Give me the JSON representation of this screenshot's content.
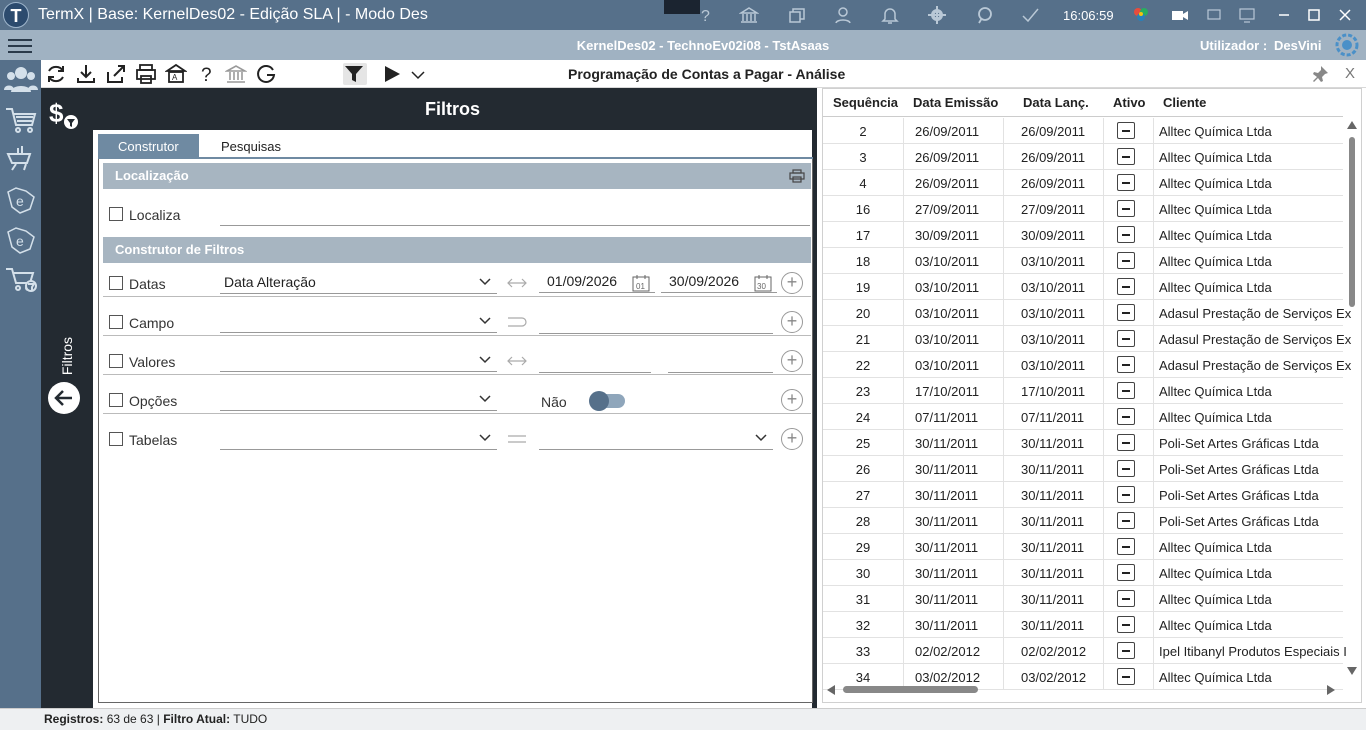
{
  "window": {
    "title": "TermX | Base: KernelDes02 - Edição SLA | - Modo Des",
    "clock": "16:06:59"
  },
  "infobar": {
    "environment": "KernelDes02 - TechnoEv02i08 - TstAsaas",
    "user_label": "Utilizador :",
    "user_name": "DesVini"
  },
  "toolbar": {
    "page_title": "Programação de Contas a Pagar - Análise",
    "close": "X"
  },
  "sidepanel": {
    "label": "Filtros"
  },
  "filters": {
    "header": "Filtros",
    "tabs": [
      "Construtor",
      "Pesquisas"
    ],
    "localizacao": {
      "section": "Localização",
      "label": "Localiza",
      "value": ""
    },
    "construtor": {
      "section": "Construtor de Filtros",
      "datas": {
        "label": "Datas",
        "field": "Data Alteração",
        "from": "01/09/2026",
        "to": "30/09/2026",
        "cal_from": "01",
        "cal_to": "30"
      },
      "campo": {
        "label": "Campo"
      },
      "valores": {
        "label": "Valores"
      },
      "opcoes": {
        "label": "Opções",
        "toggle_text": "Não",
        "toggle_on": false
      },
      "tabelas": {
        "label": "Tabelas"
      }
    }
  },
  "grid": {
    "columns": [
      "Sequência",
      "Data Emissão",
      "Data Lanç.",
      "Ativo",
      "Cliente"
    ],
    "rows": [
      {
        "seq": "2",
        "emissao": "26/09/2011",
        "lanc": "26/09/2011",
        "cliente": "Alltec Química Ltda"
      },
      {
        "seq": "3",
        "emissao": "26/09/2011",
        "lanc": "26/09/2011",
        "cliente": "Alltec Química Ltda"
      },
      {
        "seq": "4",
        "emissao": "26/09/2011",
        "lanc": "26/09/2011",
        "cliente": "Alltec Química Ltda"
      },
      {
        "seq": "16",
        "emissao": "27/09/2011",
        "lanc": "27/09/2011",
        "cliente": "Alltec Química Ltda"
      },
      {
        "seq": "17",
        "emissao": "30/09/2011",
        "lanc": "30/09/2011",
        "cliente": "Alltec Química Ltda"
      },
      {
        "seq": "18",
        "emissao": "03/10/2011",
        "lanc": "03/10/2011",
        "cliente": "Alltec Química Ltda"
      },
      {
        "seq": "19",
        "emissao": "03/10/2011",
        "lanc": "03/10/2011",
        "cliente": "Alltec Química Ltda"
      },
      {
        "seq": "20",
        "emissao": "03/10/2011",
        "lanc": "03/10/2011",
        "cliente": "Adasul Prestação de Serviços Ex"
      },
      {
        "seq": "21",
        "emissao": "03/10/2011",
        "lanc": "03/10/2011",
        "cliente": "Adasul Prestação de Serviços Ex"
      },
      {
        "seq": "22",
        "emissao": "03/10/2011",
        "lanc": "03/10/2011",
        "cliente": "Adasul Prestação de Serviços Ex"
      },
      {
        "seq": "23",
        "emissao": "17/10/2011",
        "lanc": "17/10/2011",
        "cliente": "Alltec Química Ltda"
      },
      {
        "seq": "24",
        "emissao": "07/11/2011",
        "lanc": "07/11/2011",
        "cliente": "Alltec Química Ltda"
      },
      {
        "seq": "25",
        "emissao": "30/11/2011",
        "lanc": "30/11/2011",
        "cliente": "Poli-Set Artes Gráficas Ltda"
      },
      {
        "seq": "26",
        "emissao": "30/11/2011",
        "lanc": "30/11/2011",
        "cliente": "Poli-Set Artes Gráficas Ltda"
      },
      {
        "seq": "27",
        "emissao": "30/11/2011",
        "lanc": "30/11/2011",
        "cliente": "Poli-Set Artes Gráficas Ltda"
      },
      {
        "seq": "28",
        "emissao": "30/11/2011",
        "lanc": "30/11/2011",
        "cliente": "Poli-Set Artes Gráficas Ltda"
      },
      {
        "seq": "29",
        "emissao": "30/11/2011",
        "lanc": "30/11/2011",
        "cliente": "Alltec Química Ltda"
      },
      {
        "seq": "30",
        "emissao": "30/11/2011",
        "lanc": "30/11/2011",
        "cliente": "Alltec Química Ltda"
      },
      {
        "seq": "31",
        "emissao": "30/11/2011",
        "lanc": "30/11/2011",
        "cliente": "Alltec Química Ltda"
      },
      {
        "seq": "32",
        "emissao": "30/11/2011",
        "lanc": "30/11/2011",
        "cliente": "Alltec Química Ltda"
      },
      {
        "seq": "33",
        "emissao": "02/02/2012",
        "lanc": "02/02/2012",
        "cliente": "Ipel Itibanyl Produtos Especiais I"
      },
      {
        "seq": "34",
        "emissao": "03/02/2012",
        "lanc": "03/02/2012",
        "cliente": "Alltec Química Ltda"
      }
    ]
  },
  "status": {
    "registros_label": "Registros:",
    "registros_value": "63 de 63",
    "separator": "|",
    "filtro_label": "Filtro Atual:",
    "filtro_value": "TUDO"
  },
  "icons": {
    "title": [
      "help-icon",
      "bank-icon",
      "windows-icon",
      "user-icon",
      "bell-icon",
      "gear-icon",
      "flag-icon",
      "check-icon"
    ],
    "toolbar": [
      "refresh-icon",
      "download-icon",
      "share-icon",
      "print-icon",
      "report-icon",
      "help-icon",
      "bank-icon",
      "google-icon",
      "filter-icon",
      "play-icon",
      "chevron-down-icon"
    ]
  },
  "colors": {
    "titlebar": "#56708a",
    "infobar": "#a0b2c2",
    "dark": "#232a31",
    "section": "#a7b5c1",
    "tab_active": "#6f8aa2"
  }
}
